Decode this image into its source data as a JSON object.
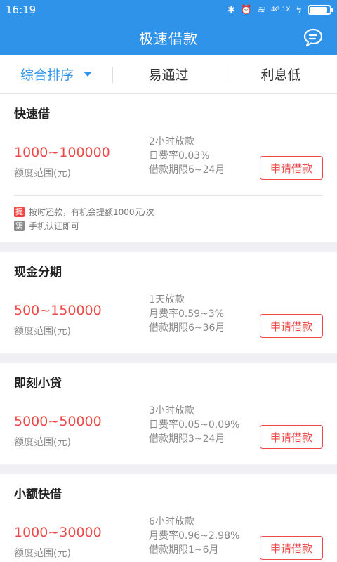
{
  "status_bar": {
    "time": "16:19",
    "signal_text": "4G 1X",
    "battery_level": 0.9
  },
  "app_bar": {
    "title": "极速借款",
    "right_icon": "message-icon"
  },
  "filters": [
    {
      "label": "综合排序",
      "active": true
    },
    {
      "label": "易通过",
      "active": false
    },
    {
      "label": "利息低",
      "active": false
    }
  ],
  "colors": {
    "primary": "#2f93ea",
    "accent_red": "#f04848",
    "background": "#efeff4"
  },
  "loans": [
    {
      "name": "快速借",
      "amount_range": "1000~100000",
      "amount_label": "额度范围(元)",
      "disbursement": "2小时放款",
      "rate": "日费率0.03%",
      "term": "借款期限6~24月",
      "apply_label": "申请借款",
      "extras": [
        {
          "tag": "提",
          "text": "按时还款，有机会提额1000元/次"
        },
        {
          "tag": "需",
          "text": "手机认证即可"
        }
      ]
    },
    {
      "name": "现金分期",
      "amount_range": "500~150000",
      "amount_label": "额度范围(元)",
      "disbursement": "1天放款",
      "rate": "月费率0.59~3%",
      "term": "借款期限6~36月",
      "apply_label": "申请借款"
    },
    {
      "name": "即刻小贷",
      "amount_range": "5000~50000",
      "amount_label": "额度范围(元)",
      "disbursement": "3小时放款",
      "rate": "日费率0.05~0.09%",
      "term": "借款期限3~24月",
      "apply_label": "申请借款"
    },
    {
      "name": "小额快借",
      "amount_range": "1000~30000",
      "amount_label": "额度范围(元)",
      "disbursement": "6小时放款",
      "rate": "月费率0.96~2.98%",
      "term": "借款期限1~6月",
      "apply_label": "申请借款"
    }
  ]
}
